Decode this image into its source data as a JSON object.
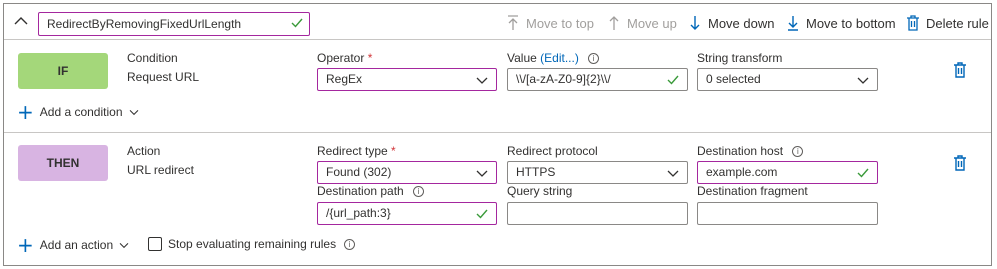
{
  "rule": {
    "name": "RedirectByRemovingFixedUrlLength"
  },
  "toolbar": {
    "move_to_top": "Move to top",
    "move_up": "Move up",
    "move_down": "Move down",
    "move_to_bottom": "Move to bottom",
    "delete_rule": "Delete rule"
  },
  "condition": {
    "pill": "IF",
    "heading": "Condition",
    "type": "Request URL",
    "operator_label": "Operator",
    "required_mark": "*",
    "operator_value": "RegEx",
    "value_label": "Value",
    "value_edit": "(Edit...)",
    "value_value": "\\\\/[a-zA-Z0-9]{2}\\\\/",
    "transform_label": "String transform",
    "transform_value": "0 selected",
    "add_label": "Add a condition"
  },
  "action": {
    "pill": "THEN",
    "heading": "Action",
    "type": "URL redirect",
    "redirect_type_label": "Redirect type",
    "redirect_type_value": "Found (302)",
    "protocol_label": "Redirect protocol",
    "protocol_value": "HTTPS",
    "host_label": "Destination host",
    "host_value": "example.com",
    "path_label": "Destination path",
    "path_value": "/{url_path:3}",
    "query_label": "Query string",
    "query_value": "",
    "fragment_label": "Destination fragment",
    "fragment_value": "",
    "add_label": "Add an action",
    "stop_label": "Stop evaluating remaining rules"
  },
  "colors": {
    "accent": "#0067b8",
    "focus_border": "#a4279e",
    "if_pill": "#a4d77a",
    "then_pill": "#d8b4e2",
    "check": "#3a9a3a",
    "disabled": "#a19f9d"
  }
}
